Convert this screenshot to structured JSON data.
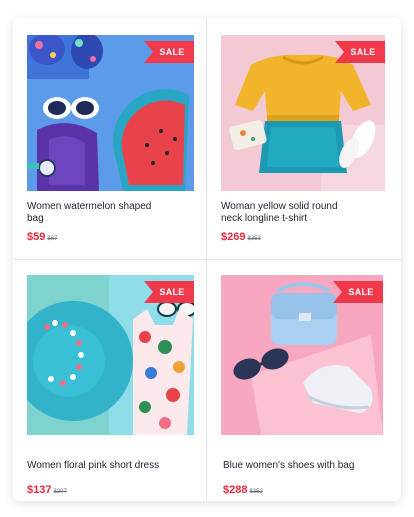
{
  "products": [
    {
      "title": "Women watermelon shaped bag",
      "price": "$59",
      "old_price": "$67",
      "badge": "SALE"
    },
    {
      "title": "Woman yellow solid round neck longline t-shirt",
      "price": "$269",
      "old_price": "$353",
      "badge": "SALE"
    },
    {
      "title": "Women floral pink short dress",
      "price": "$137",
      "old_price": "$207",
      "badge": "SALE"
    },
    {
      "title": "Blue women's shoes with bag",
      "price": "$288",
      "old_price": "$352",
      "badge": "SALE"
    }
  ],
  "colors": {
    "sale_badge": "#f0394a",
    "price": "#e8283c",
    "divider": "#e3e6f2"
  }
}
